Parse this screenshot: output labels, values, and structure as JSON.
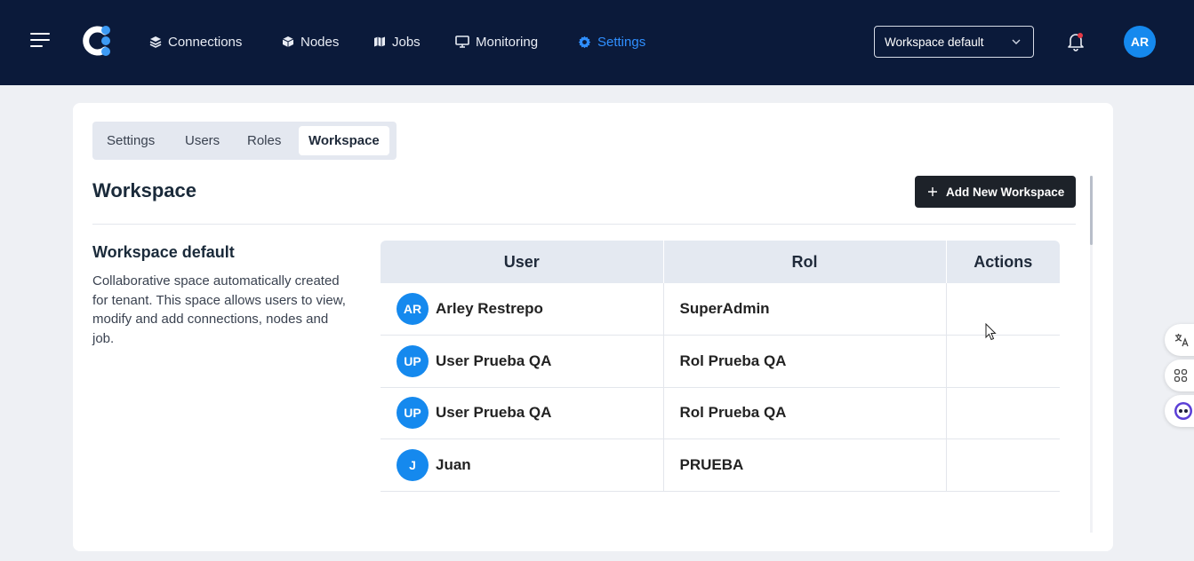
{
  "nav": {
    "items": [
      {
        "label": "Connections",
        "icon": "layers-icon"
      },
      {
        "label": "Nodes",
        "icon": "cube-icon"
      },
      {
        "label": "Jobs",
        "icon": "map-icon"
      },
      {
        "label": "Monitoring",
        "icon": "monitor-icon"
      },
      {
        "label": "Settings",
        "icon": "gear-icon",
        "active": true
      }
    ],
    "workspace_select": "Workspace default",
    "user_initials": "AR"
  },
  "tabs": [
    "Settings",
    "Users",
    "Roles",
    "Workspace"
  ],
  "active_tab": "Workspace",
  "page": {
    "title": "Workspace",
    "add_button": "Add New Workspace"
  },
  "workspace": {
    "name": "Workspace default",
    "description": "Collaborative space automatically created for tenant. This space allows users to view, modify and add connections, nodes and job."
  },
  "table": {
    "headers": [
      "User",
      "Rol",
      "Actions"
    ],
    "rows": [
      {
        "initials": "AR",
        "user": "Arley Restrepo",
        "rol": "SuperAdmin"
      },
      {
        "initials": "UP",
        "user": "User Prueba QA",
        "rol": "Rol Prueba QA"
      },
      {
        "initials": "UP",
        "user": "User Prueba QA",
        "rol": "Rol Prueba QA"
      },
      {
        "initials": "J",
        "user": "Juan",
        "rol": "PRUEBA"
      }
    ]
  },
  "colors": {
    "topbar": "#0b1a3a",
    "accent": "#2f8fff",
    "avatar": "#1589ee",
    "button_dark": "#1d2229"
  }
}
